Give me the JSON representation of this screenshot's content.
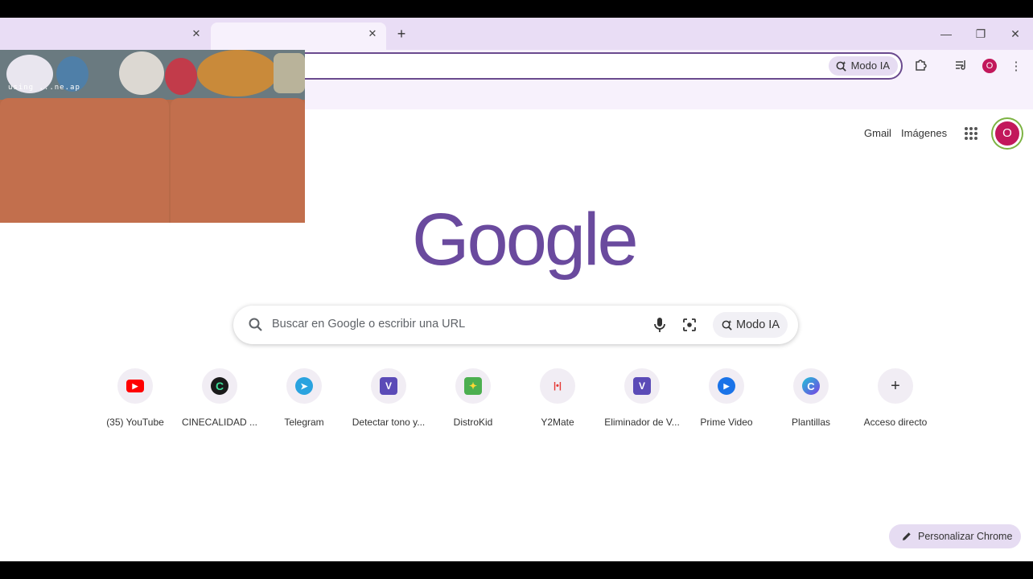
{
  "browser": {
    "ai_mode_chip": "Modo IA",
    "profile_letter": "O"
  },
  "header_links": {
    "gmail": "Gmail",
    "images": "Imágenes",
    "avatar_letter": "O"
  },
  "logo": "Google",
  "search": {
    "placeholder": "Buscar en Google o escribir una URL",
    "ai_mode_label": "Modo IA"
  },
  "shortcuts": [
    {
      "label": "(35) YouTube",
      "icon": "youtube-icon",
      "color": "#ff0000"
    },
    {
      "label": "CINECALIDAD ...",
      "icon": "cinecalidad-icon",
      "color": "#1a1a1a"
    },
    {
      "label": "Telegram",
      "icon": "telegram-icon",
      "color": "#2aa3df"
    },
    {
      "label": "Detectar tono y...",
      "icon": "v-letter-icon",
      "color": "#5b4bb7"
    },
    {
      "label": "DistroKid",
      "icon": "distrokid-icon",
      "color": "#4caf50"
    },
    {
      "label": "Y2Mate",
      "icon": "y2mate-icon",
      "color": "#e53935"
    },
    {
      "label": "Eliminador de V...",
      "icon": "v-letter-icon",
      "color": "#5b4bb7"
    },
    {
      "label": "Prime Video",
      "icon": "prime-video-icon",
      "color": "#1a73e8"
    },
    {
      "label": "Plantillas",
      "icon": "canva-icon",
      "color": "#7b3fe4"
    },
    {
      "label": "Acceso directo",
      "icon": "plus-icon",
      "color": "#333333"
    }
  ],
  "customize_label": "Personalizar Chrome",
  "webcam_text": "using ...ne.ap"
}
